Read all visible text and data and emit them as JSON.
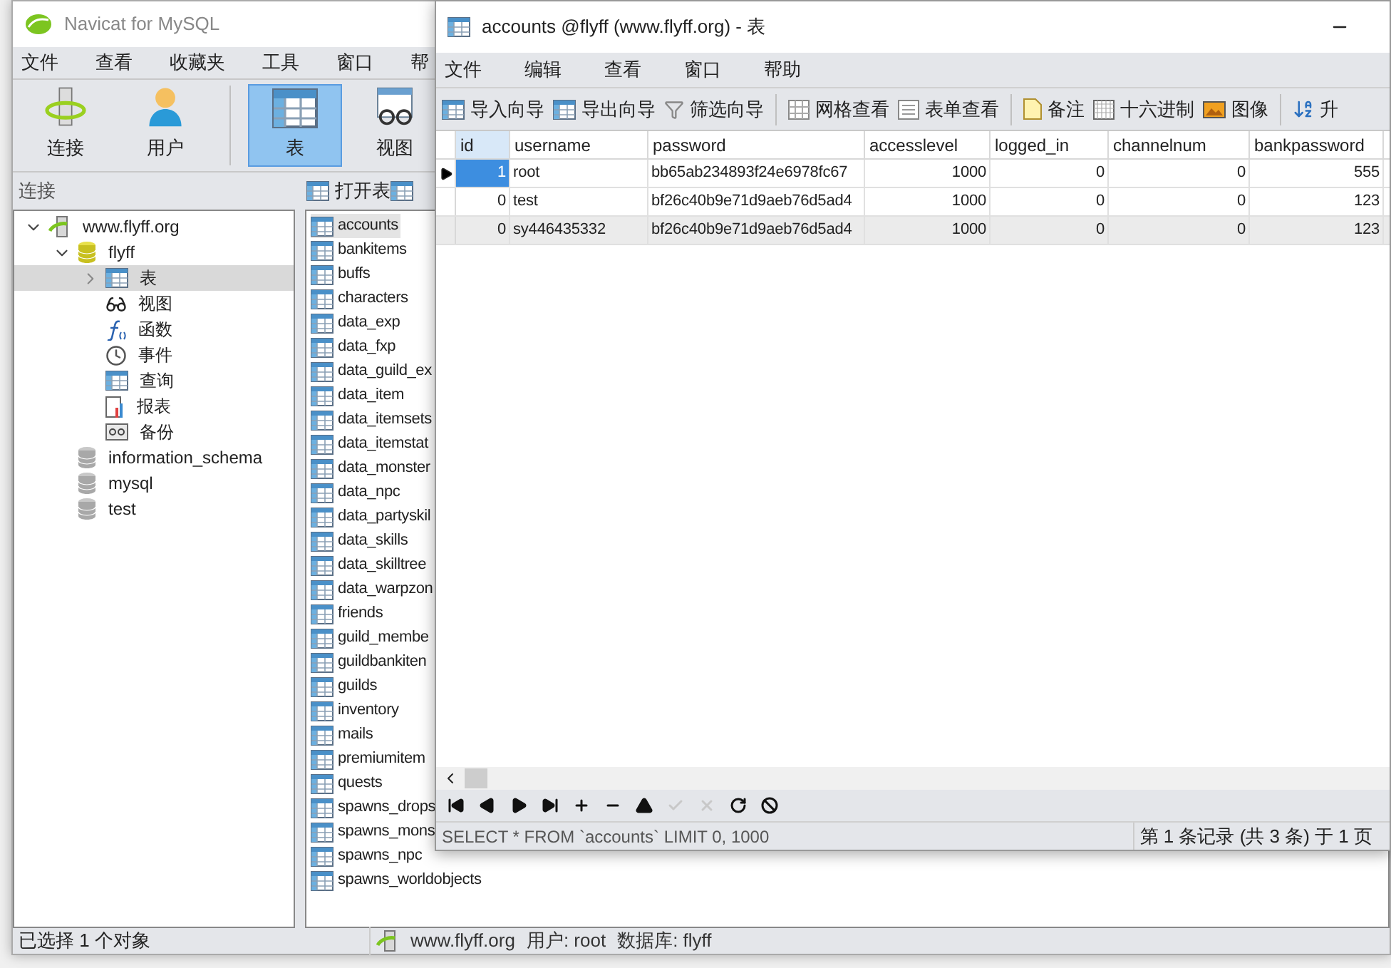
{
  "back_window": {
    "title": "Navicat for MySQL",
    "menu": [
      "文件",
      "查看",
      "收藏夹",
      "工具",
      "窗口",
      "帮"
    ],
    "toolbar": [
      {
        "kind": "connect",
        "label": "连接",
        "selected": false
      },
      {
        "kind": "user",
        "label": "用户",
        "selected": false
      },
      {
        "kind": "table",
        "label": "表",
        "selected": true
      },
      {
        "kind": "view",
        "label": "视图",
        "selected": false
      }
    ],
    "pane_header": "连接",
    "object_toolbar": [
      "打开表"
    ],
    "tree": [
      {
        "label": "www.flyff.org",
        "kind": "server",
        "expanded": true,
        "selected": false,
        "children": [
          {
            "label": "flyff",
            "kind": "db",
            "expanded": true,
            "selected": false,
            "children": [
              {
                "label": "表",
                "kind": "table",
                "selected": true,
                "expanded": false
              },
              {
                "label": "视图",
                "kind": "view",
                "selected": false
              },
              {
                "label": "函数",
                "kind": "func",
                "selected": false
              },
              {
                "label": "事件",
                "kind": "event",
                "selected": false
              },
              {
                "label": "查询",
                "kind": "query",
                "selected": false
              },
              {
                "label": "报表",
                "kind": "report",
                "selected": false
              },
              {
                "label": "备份",
                "kind": "backup",
                "selected": false
              }
            ]
          },
          {
            "label": "information_schema",
            "kind": "db-off",
            "selected": false
          },
          {
            "label": "mysql",
            "kind": "db-off",
            "selected": false
          },
          {
            "label": "test",
            "kind": "db-off",
            "selected": false
          }
        ]
      }
    ],
    "tables": [
      {
        "label": "accounts",
        "selected": true
      },
      {
        "label": "bankitems",
        "selected": false
      },
      {
        "label": "buffs",
        "selected": false
      },
      {
        "label": "characters",
        "selected": false
      },
      {
        "label": "data_exp",
        "selected": false
      },
      {
        "label": "data_fxp",
        "selected": false
      },
      {
        "label": "data_guild_ex",
        "selected": false
      },
      {
        "label": "data_item",
        "selected": false
      },
      {
        "label": "data_itemsets",
        "selected": false
      },
      {
        "label": "data_itemstat",
        "selected": false
      },
      {
        "label": "data_monster",
        "selected": false
      },
      {
        "label": "data_npc",
        "selected": false
      },
      {
        "label": "data_partyskil",
        "selected": false
      },
      {
        "label": "data_skills",
        "selected": false
      },
      {
        "label": "data_skilltree",
        "selected": false
      },
      {
        "label": "data_warpzon",
        "selected": false
      },
      {
        "label": "friends",
        "selected": false
      },
      {
        "label": "guild_membe",
        "selected": false
      },
      {
        "label": "guildbankiten",
        "selected": false
      },
      {
        "label": "guilds",
        "selected": false
      },
      {
        "label": "inventory",
        "selected": false
      },
      {
        "label": "mails",
        "selected": false
      },
      {
        "label": "premiumitem",
        "selected": false
      },
      {
        "label": "quests",
        "selected": false
      },
      {
        "label": "spawns_drops",
        "selected": false
      },
      {
        "label": "spawns_mons",
        "selected": false
      },
      {
        "label": "spawns_npc",
        "selected": false
      },
      {
        "label": "spawns_worldobjects",
        "selected": false
      }
    ],
    "status_left": "已选择 1 个对象",
    "status_right": [
      "www.flyff.org",
      "用户: root",
      "数据库: flyff"
    ]
  },
  "front_window": {
    "title": "accounts @flyff (www.flyff.org) - 表",
    "menu": [
      "文件",
      "编辑",
      "查看",
      "窗口",
      "帮助"
    ],
    "toolbar": [
      {
        "kind": "import",
        "label": "导入向导"
      },
      {
        "kind": "export",
        "label": "导出向导"
      },
      {
        "kind": "filter",
        "label": "筛选向导"
      },
      {
        "kind": "sep"
      },
      {
        "kind": "grid",
        "label": "网格查看"
      },
      {
        "kind": "form",
        "label": "表单查看"
      },
      {
        "kind": "sep"
      },
      {
        "kind": "note",
        "label": "备注"
      },
      {
        "kind": "hex",
        "label": "十六进制"
      },
      {
        "kind": "image",
        "label": "图像"
      },
      {
        "kind": "sep"
      },
      {
        "kind": "sort",
        "label": "升"
      }
    ],
    "table": {
      "columns": [
        "id",
        "username",
        "password",
        "accesslevel",
        "logged_in",
        "channelnum",
        "bankpassword"
      ],
      "rows": [
        {
          "selected": true,
          "hovered": false,
          "cells": [
            "1",
            "root",
            "bb65ab234893f24e6978fc67",
            "1000",
            "0",
            "0",
            "555"
          ]
        },
        {
          "selected": false,
          "hovered": false,
          "cells": [
            "0",
            "test",
            "bf26c40b9e71d9aeb76d5ad4",
            "1000",
            "0",
            "0",
            "123"
          ]
        },
        {
          "selected": false,
          "hovered": true,
          "cells": [
            "0",
            "sy446435332",
            "bf26c40b9e71d9aeb76d5ad4",
            "1000",
            "0",
            "0",
            "123"
          ]
        }
      ]
    },
    "nav_buttons": [
      {
        "kind": "first",
        "disabled": false
      },
      {
        "kind": "prev",
        "disabled": false
      },
      {
        "kind": "next",
        "disabled": false
      },
      {
        "kind": "last",
        "disabled": false
      },
      {
        "kind": "add",
        "disabled": false
      },
      {
        "kind": "delete",
        "disabled": false
      },
      {
        "kind": "up",
        "disabled": false
      },
      {
        "kind": "apply",
        "disabled": true
      },
      {
        "kind": "cancel",
        "disabled": true
      },
      {
        "kind": "refresh",
        "disabled": false
      },
      {
        "kind": "stop",
        "disabled": false
      }
    ],
    "status_query": "SELECT * FROM `accounts` LIMIT 0, 1000",
    "status_record": "第 1 条记录 (共 3 条) 于 1 页"
  }
}
